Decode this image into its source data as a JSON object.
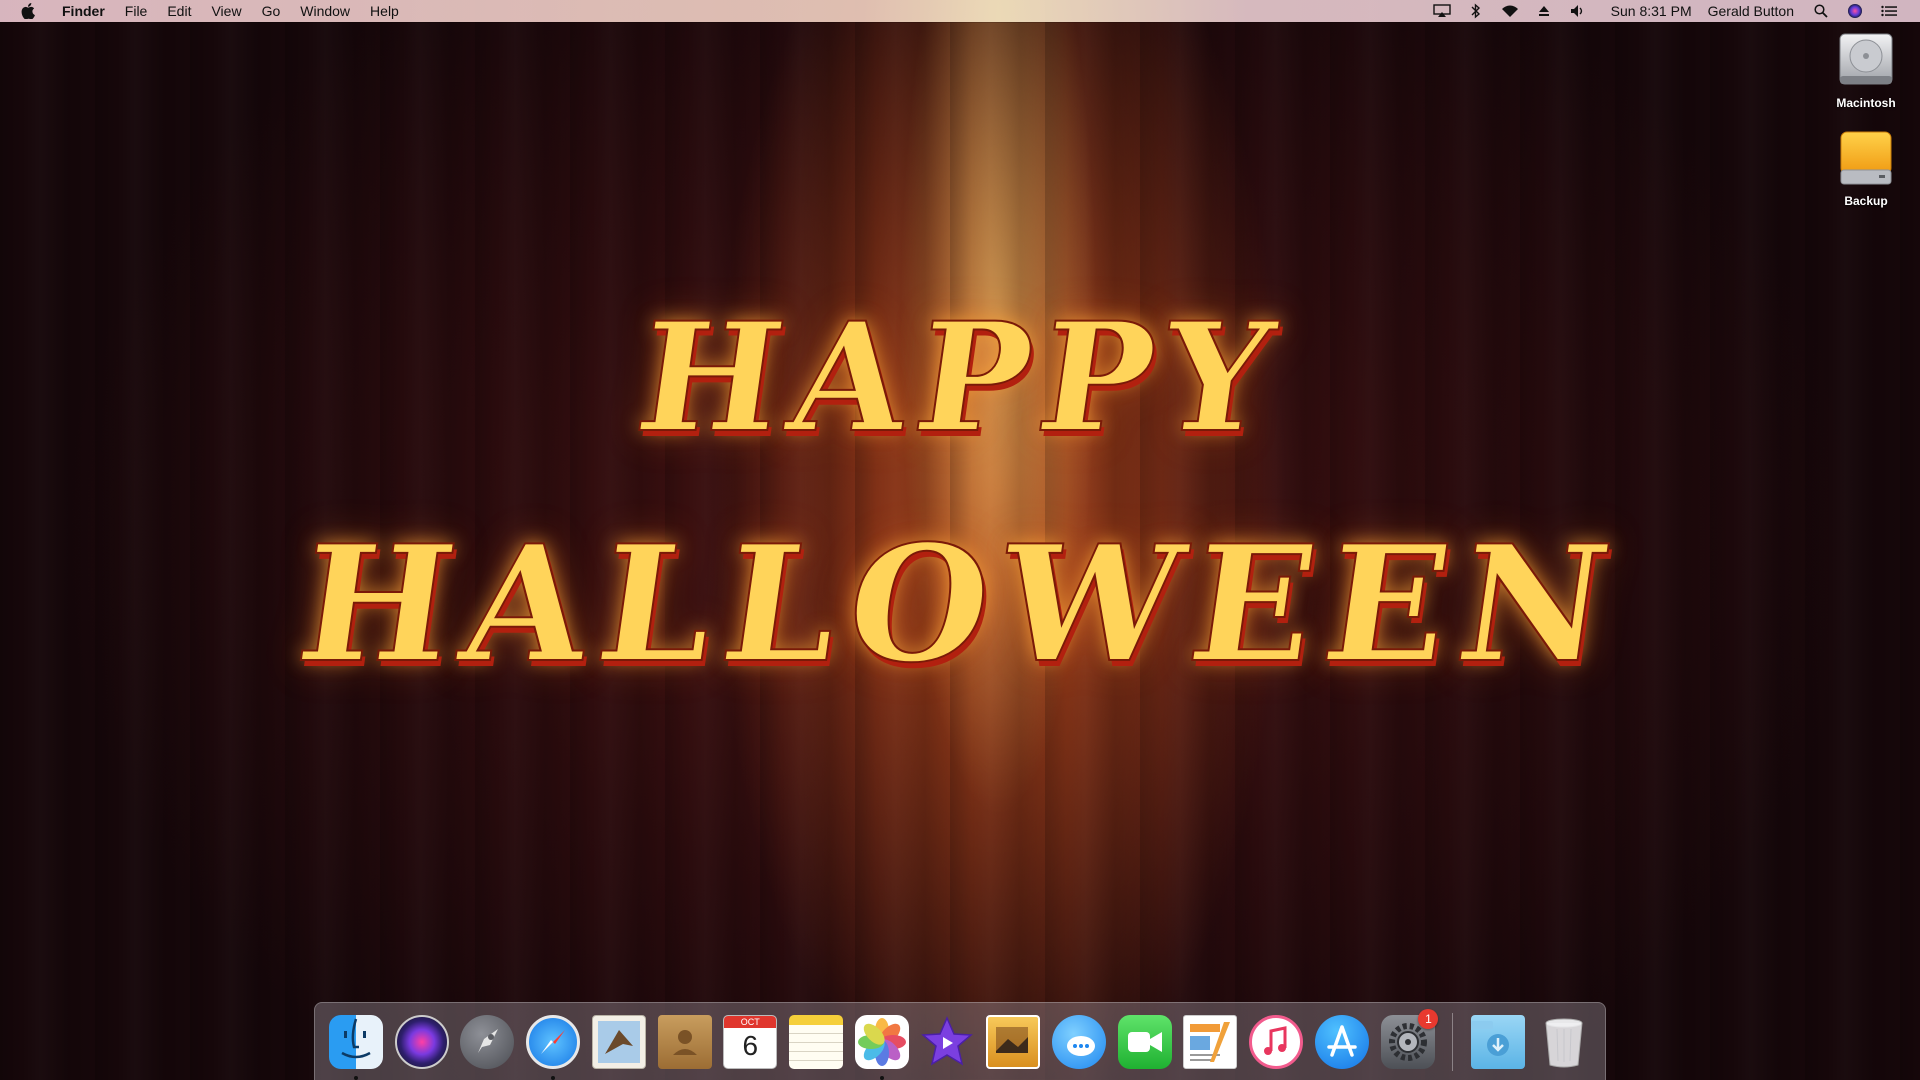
{
  "menubar": {
    "app_name": "Finder",
    "menus": [
      "File",
      "Edit",
      "View",
      "Go",
      "Window",
      "Help"
    ],
    "clock": "Sun 8:31 PM",
    "user": "Gerald Button",
    "status_icons": [
      "airplay-icon",
      "bluetooth-icon",
      "wifi-icon",
      "eject-icon",
      "volume-icon"
    ]
  },
  "desktop": {
    "icons": [
      {
        "label": "Macintosh",
        "icon": "hard-drive-icon"
      },
      {
        "label": "Backup",
        "icon": "external-drive-icon"
      }
    ],
    "wallpaper_text": [
      "HAPPY",
      "HALLOWEEN"
    ]
  },
  "dock": {
    "calendar": {
      "month": "OCT",
      "day": "6"
    },
    "system_preferences_badge": "1",
    "apps": [
      "finder-icon",
      "siri-icon",
      "launchpad-icon",
      "safari-icon",
      "mail-icon",
      "contacts-icon",
      "calendar-icon",
      "notes-icon",
      "photos-icon",
      "imovie-icon",
      "preview-icon",
      "messages-icon",
      "facetime-icon",
      "pages-icon",
      "itunes-icon",
      "app-store-icon",
      "system-preferences-icon"
    ],
    "running": [
      "finder-icon",
      "safari-icon",
      "photos-icon"
    ],
    "extras": [
      "downloads-folder-icon",
      "trash-icon"
    ]
  },
  "colors": {
    "title_fill": "#ffd45a",
    "title_shadow": "#b2200f",
    "badge": "#e8392f"
  }
}
